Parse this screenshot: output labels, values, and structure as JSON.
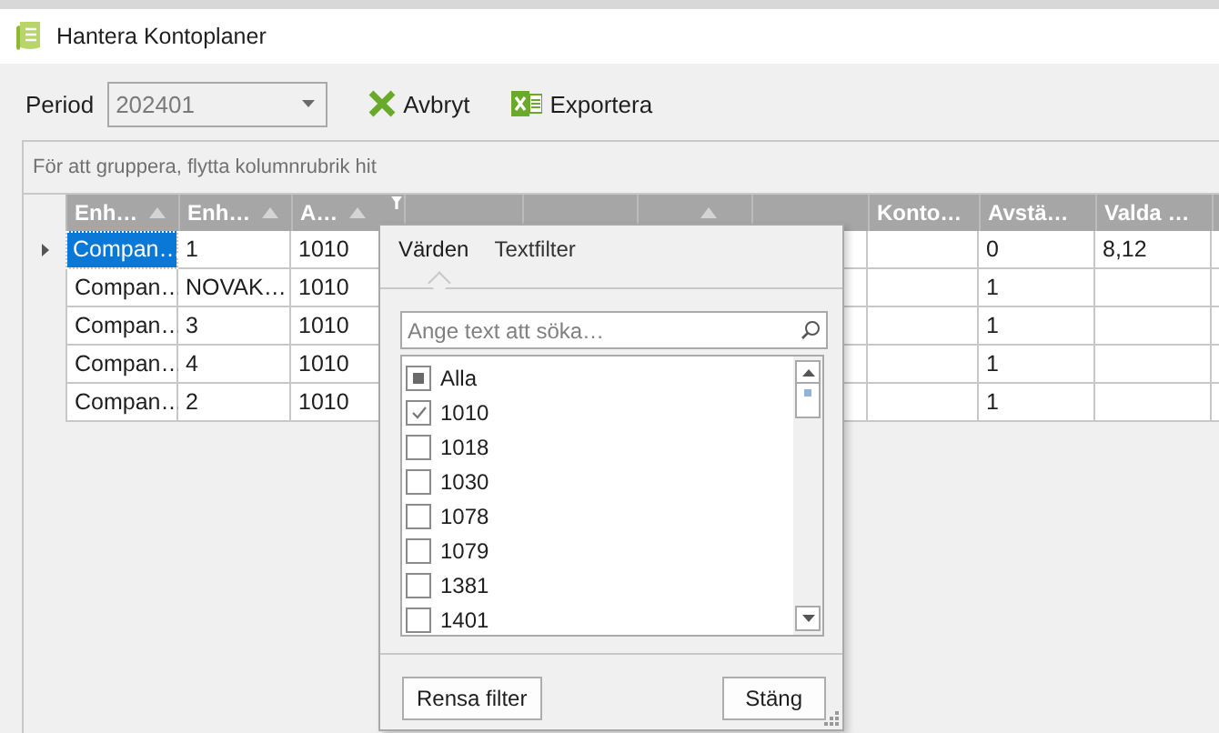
{
  "window": {
    "title": "Hantera Kontoplaner"
  },
  "toolbar": {
    "period_label": "Period",
    "period_value": "202401",
    "buttons": [
      {
        "kind": "cancel",
        "label": "Avbryt"
      },
      {
        "kind": "export",
        "label": "Exportera"
      }
    ]
  },
  "grid": {
    "group_hint": "För att gruppera, flytta kolumnrubrik hit",
    "columns": [
      {
        "label": "Enh…",
        "sorted": true,
        "filtered": false
      },
      {
        "label": "Enh…",
        "sorted": true,
        "filtered": false
      },
      {
        "label": "A…",
        "sorted": true,
        "filtered": true
      },
      {
        "sorted": false,
        "filtered": false
      },
      {
        "sorted": false,
        "filtered": false
      },
      {
        "sorted": true,
        "filtered": false
      },
      {
        "sorted": false,
        "filtered": false
      },
      {
        "label": "Konto…",
        "sorted": false,
        "filtered": false
      },
      {
        "label": "Avstä…",
        "sorted": false,
        "filtered": false
      },
      {
        "label": "Valda …",
        "sorted": false,
        "filtered": false
      }
    ],
    "rows": [
      {
        "selected": true,
        "cells": [
          "Compan…",
          "1",
          "1010",
          null,
          null,
          null,
          null,
          null,
          "0",
          "8,12"
        ]
      },
      {
        "selected": false,
        "cells": [
          "Compan…",
          "NOVAK…",
          "1010",
          null,
          null,
          null,
          null,
          null,
          "1",
          null
        ]
      },
      {
        "selected": false,
        "cells": [
          "Compan…",
          "3",
          "1010",
          null,
          null,
          null,
          null,
          null,
          "1",
          null
        ]
      },
      {
        "selected": false,
        "cells": [
          "Compan…",
          "4",
          "1010",
          null,
          null,
          null,
          null,
          null,
          "1",
          null
        ]
      },
      {
        "selected": false,
        "cells": [
          "Compan…",
          "2",
          "1010",
          null,
          null,
          null,
          null,
          null,
          "1",
          null
        ]
      }
    ]
  },
  "filter_popup": {
    "tabs": [
      {
        "label": "Värden",
        "selected": true
      },
      {
        "label": "Textfilter",
        "selected": false
      }
    ],
    "search": {
      "placeholder": "Ange text att söka…"
    },
    "items": [
      {
        "label": "Alla",
        "checked": false,
        "indeterminate": true
      },
      {
        "label": "1010",
        "checked": true,
        "indeterminate": false
      },
      {
        "label": "1018",
        "checked": false,
        "indeterminate": false
      },
      {
        "label": "1030",
        "checked": false,
        "indeterminate": false
      },
      {
        "label": "1078",
        "checked": false,
        "indeterminate": false
      },
      {
        "label": "1079",
        "checked": false,
        "indeterminate": false
      },
      {
        "label": "1381",
        "checked": false,
        "indeterminate": false
      },
      {
        "label": "1401",
        "checked": false,
        "indeterminate": false
      }
    ],
    "buttons": [
      {
        "kind": "clear",
        "label": "Rensa filter"
      },
      {
        "kind": "close",
        "label": "Stäng"
      }
    ]
  }
}
